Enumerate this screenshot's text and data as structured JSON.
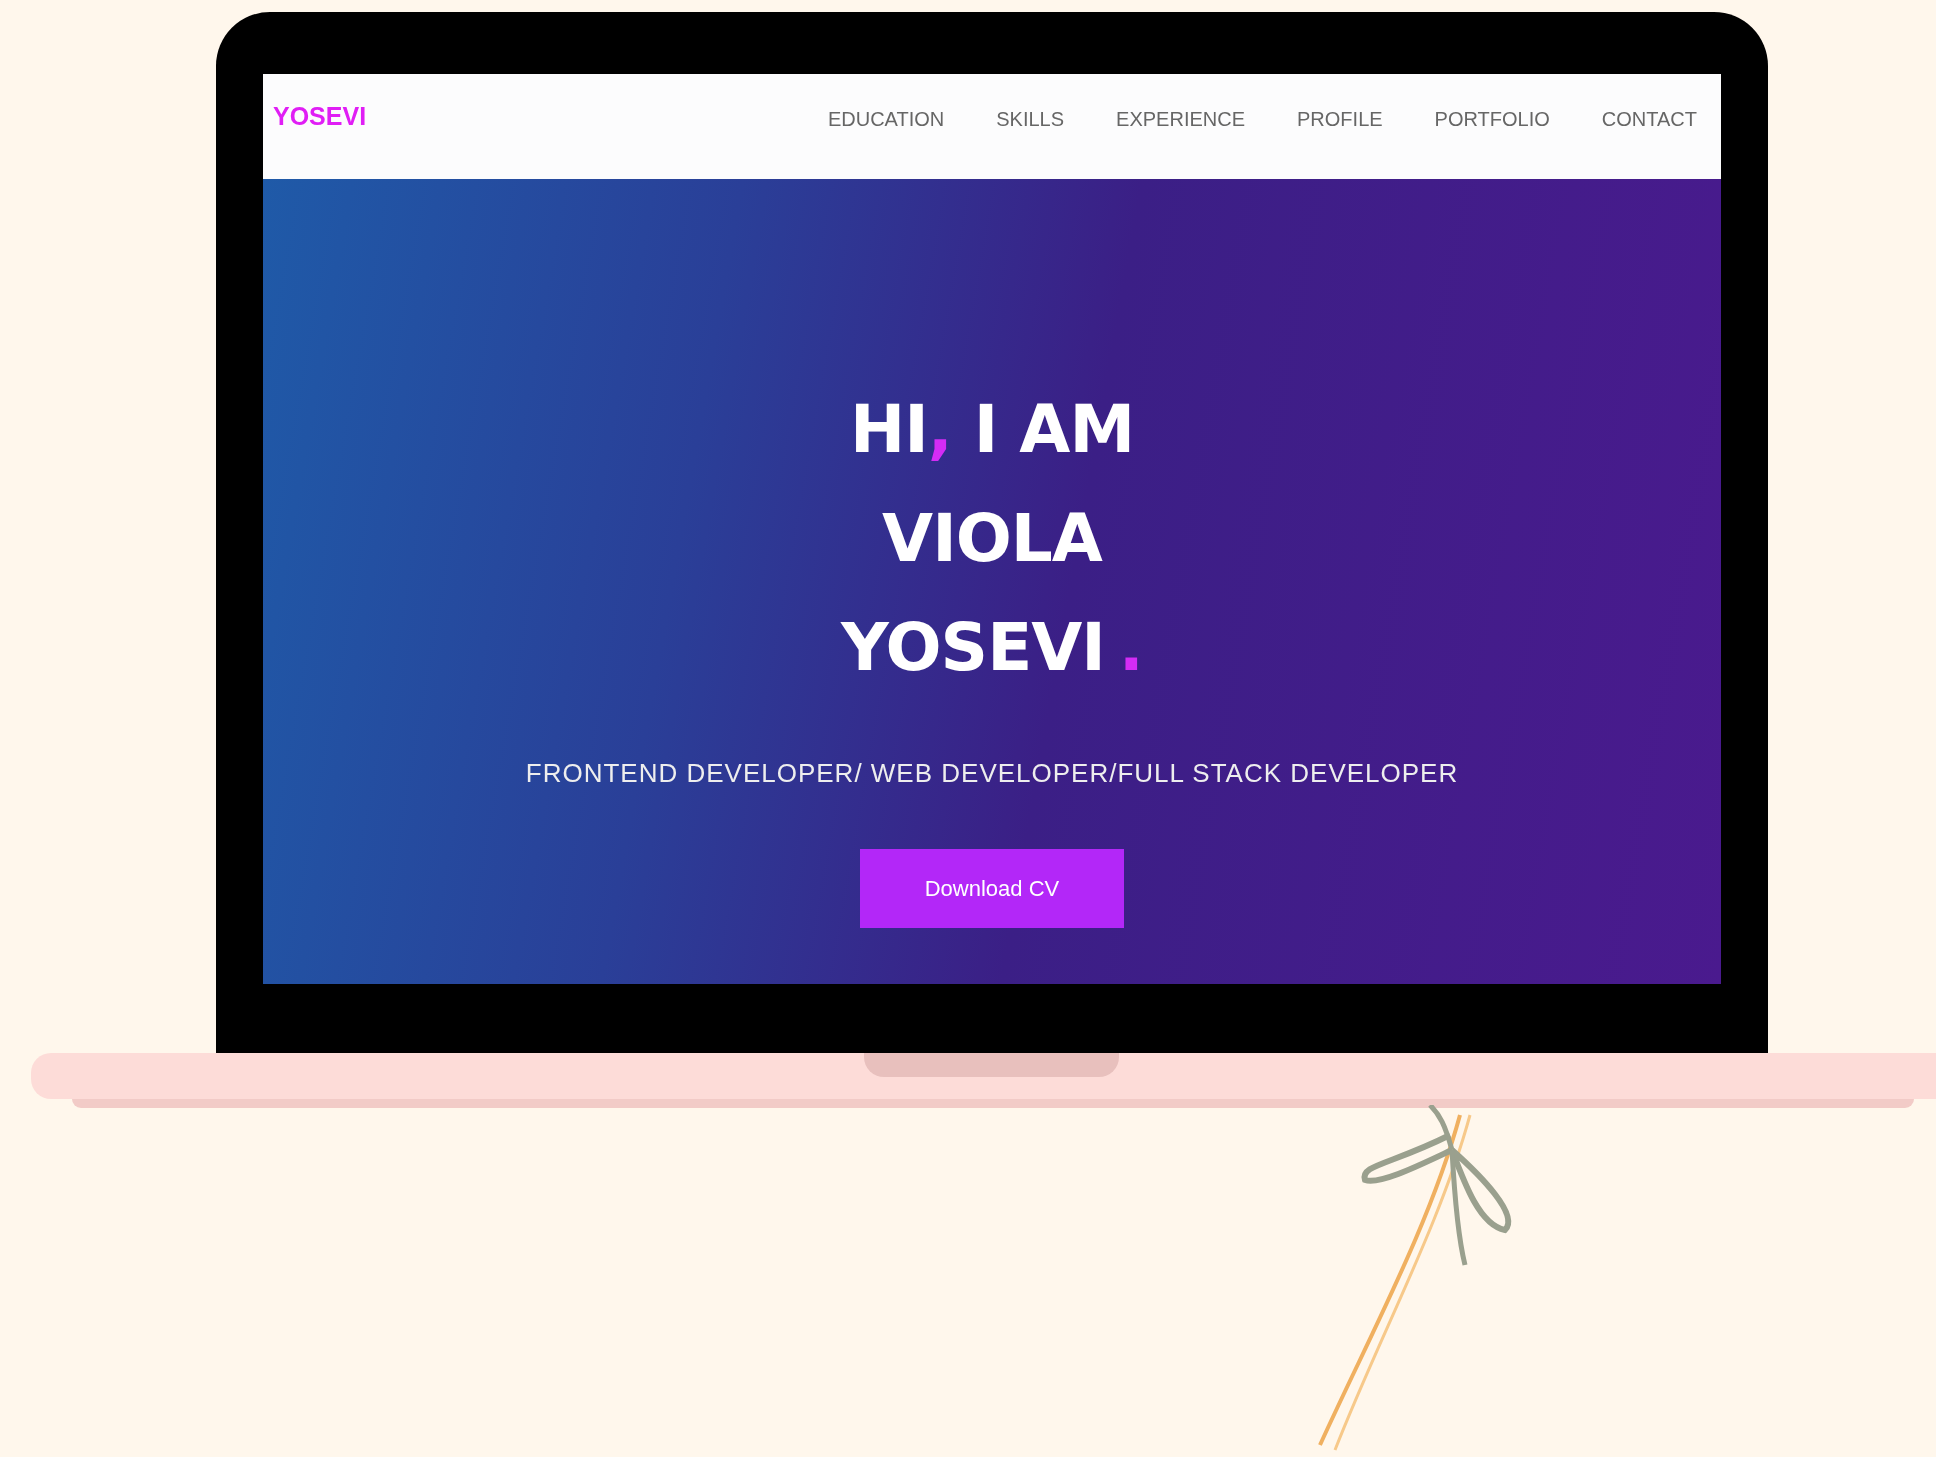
{
  "nav": {
    "logo": "YOSEVI",
    "links": [
      {
        "label": "EDUCATION"
      },
      {
        "label": "SKILLS"
      },
      {
        "label": "EXPERIENCE"
      },
      {
        "label": "PROFILE"
      },
      {
        "label": "PORTFOLIO"
      },
      {
        "label": "CONTACT"
      }
    ]
  },
  "hero": {
    "heading": [
      {
        "text": "HI",
        "accent": ",",
        "after": " I AM"
      },
      {
        "text": "VIOLA"
      },
      {
        "text": "YOSEVI",
        "accent": "."
      }
    ],
    "subtitle": "FRONTEND DEVELOPER/ WEB DEVELOPER/FULL STACK DEVELOPER",
    "button": "Download CV"
  }
}
